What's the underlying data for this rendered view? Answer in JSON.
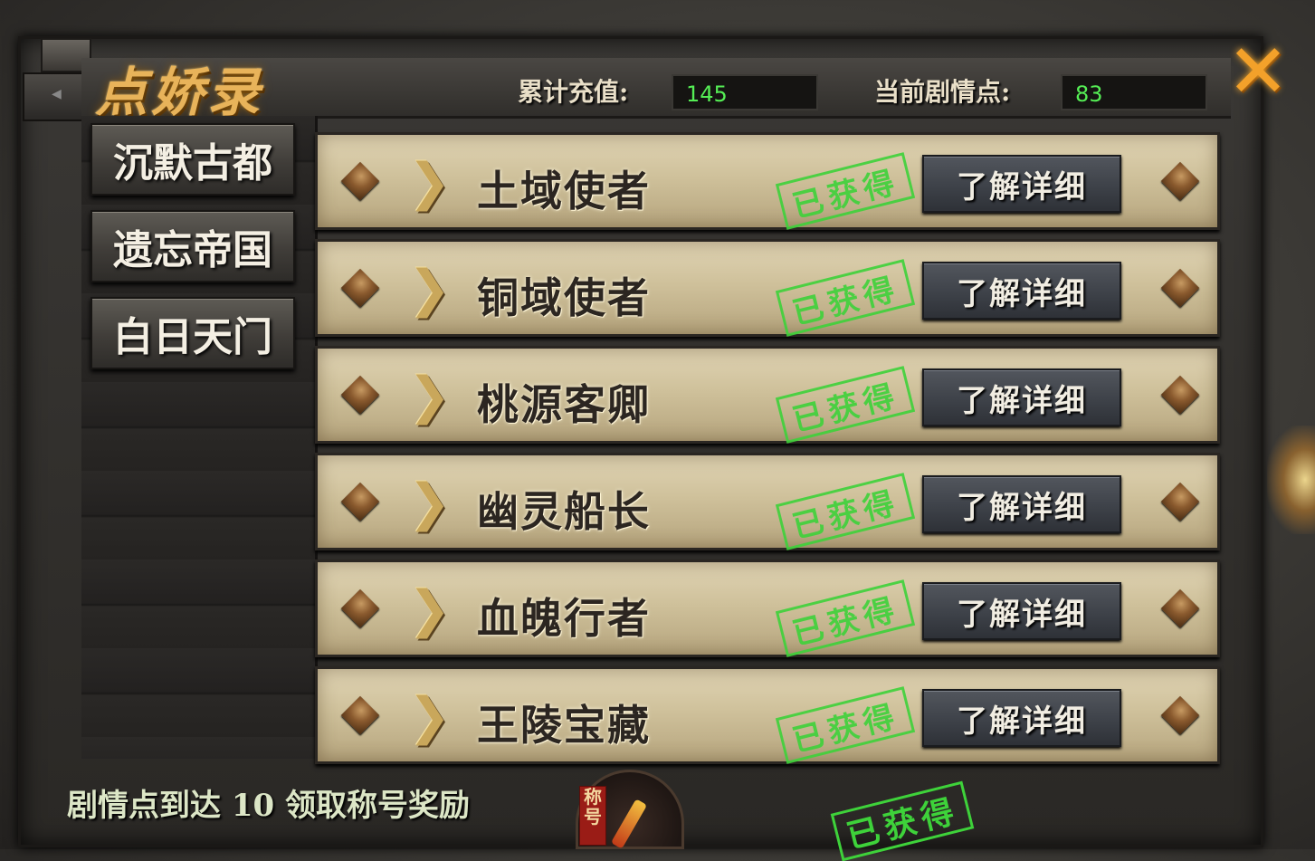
{
  "header": {
    "title": "点娇录",
    "total_recharge_label": "累计充值:",
    "total_recharge_value": "145",
    "story_points_label": "当前剧情点:",
    "story_points_value": "83"
  },
  "sidebar": {
    "items": [
      {
        "label": "沉默古都"
      },
      {
        "label": "遗忘帝国"
      },
      {
        "label": "白日天门"
      }
    ]
  },
  "rows": [
    {
      "name": "土域使者",
      "stamp": "已获得",
      "button": "了解详细"
    },
    {
      "name": "铜域使者",
      "stamp": "已获得",
      "button": "了解详细"
    },
    {
      "name": "桃源客卿",
      "stamp": "已获得",
      "button": "了解详细"
    },
    {
      "name": "幽灵船长",
      "stamp": "已获得",
      "button": "了解详细"
    },
    {
      "name": "血魄行者",
      "stamp": "已获得",
      "button": "了解详细"
    },
    {
      "name": "王陵宝藏",
      "stamp": "已获得",
      "button": "了解详细"
    }
  ],
  "footer": {
    "reward_text": "剧情点到达 10 领取称号奖励",
    "badge_tag": "称号",
    "stamp": "已获得"
  },
  "icons": {
    "close": "close-icon",
    "row_left": "diamond-stud-icon",
    "row_arrow": "chevron-right-icon"
  },
  "colors": {
    "stamp_green": "#3ed23a",
    "value_green": "#55ee55",
    "title_gold": "#e8b35a",
    "close_orange": "#f3a12a"
  }
}
